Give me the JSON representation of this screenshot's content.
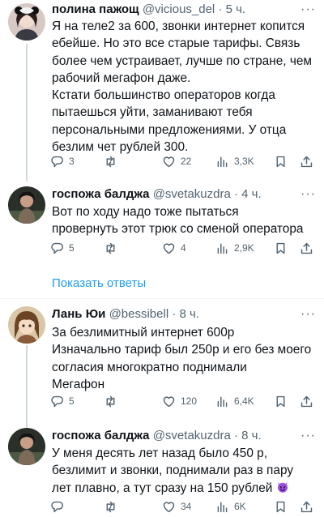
{
  "tweets": [
    {
      "name": "полина пажощ",
      "handle": "@vicious_del",
      "time": "5 ч.",
      "lines": [
        "Я на теле2 за 600, звонки интернет копится",
        "ебейше. Но это все старые тарифы. Связь",
        "более чем устраивает,  лучше по стране, чем",
        "рабочий мегафон даже.",
        "Кстати большинство операторов когда",
        "пытаешься уйти, заманивают тебя",
        "персональными предложениями. У отца",
        "безлим чет рублей 300."
      ],
      "replies": "3",
      "retweets": "",
      "likes": "22",
      "views": "3,3K"
    },
    {
      "name": "госпожа балджа",
      "handle": "@svetakuzdra",
      "time": "4 ч.",
      "lines": [
        "Вот по ходу надо тоже пытаться",
        "провернуть этот трюк со сменой оператора"
      ],
      "replies": "5",
      "retweets": "",
      "likes": "4",
      "views": "2,9K"
    },
    {
      "name": "Лань Юи",
      "handle": "@bessibell",
      "time": "8 ч.",
      "lines": [
        "За безлимитный интернет 600р",
        "Изначально тариф был 250р и его без моего",
        "согласия многократно поднимали",
        "Мегафон"
      ],
      "replies": "5",
      "retweets": "",
      "likes": "120",
      "views": "6,4K"
    },
    {
      "name": "госпожа балджа",
      "handle": "@svetakuzdra",
      "time": "8 ч.",
      "lines": [
        "У меня десять лет назад было 450 р,",
        "безлимит и звонки, поднимали раз в пару",
        "лет плавно, а тут сразу на 150 рублей"
      ],
      "replies": "",
      "retweets": "",
      "likes": "34",
      "views": "6K"
    }
  ],
  "show_replies_label": "Показать ответы",
  "dot": "·",
  "colors": {
    "text": "#0f1419",
    "secondary": "#536471",
    "link": "#1d9bf0",
    "divider": "#eff3f4",
    "thread_line": "#cfd9de"
  },
  "icons": [
    "reply-icon",
    "retweet-icon",
    "like-icon",
    "views-icon",
    "bookmark-icon",
    "share-icon",
    "more-icon",
    "devil-emoji"
  ]
}
